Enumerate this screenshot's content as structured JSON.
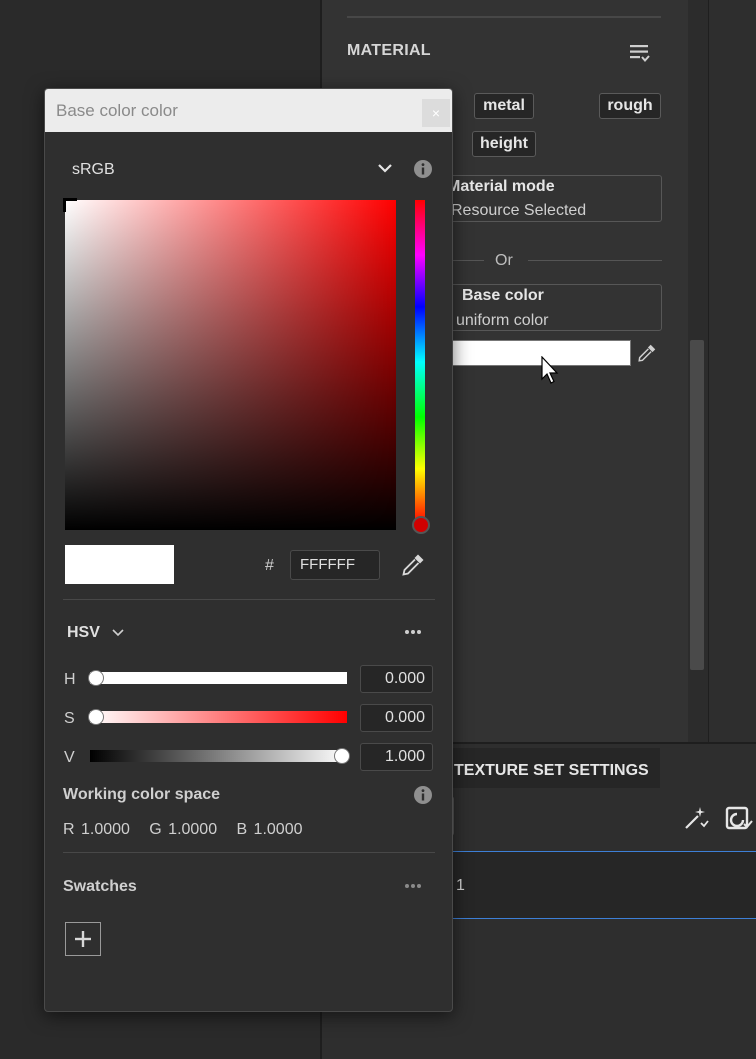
{
  "background": {
    "material_title": "MATERIAL",
    "chips": {
      "metal": "metal",
      "rough": "rough",
      "height": "height"
    },
    "material_mode": {
      "title": "Material mode",
      "value": "Resource Selected"
    },
    "or_text": "Or",
    "base_color": {
      "title": "Base color",
      "value": "uniform color",
      "swatch_color": "#FFFFFF"
    },
    "texture_set": {
      "title": "TEXTURE SET SETTINGS",
      "row_text": "1"
    },
    "icons": [
      "list-filter-icon",
      "eyedropper-icon",
      "cursor-icon",
      "magic-wand-icon",
      "refresh-icon"
    ]
  },
  "picker": {
    "title": "Base color color",
    "close_label": "×",
    "color_space": "sRGB",
    "hash": "#",
    "hex_value": "FFFFFF",
    "mode": "HSV",
    "more_label": "•••",
    "channels": [
      {
        "label": "H",
        "value": "0.000"
      },
      {
        "label": "S",
        "value": "0.000"
      },
      {
        "label": "V",
        "value": "1.000"
      }
    ],
    "working_color_space": {
      "title": "Working color space",
      "values": "R 1.0000   G 1.0000   B 1.0000"
    },
    "swatches_title": "Swatches",
    "current_color": "#FFFFFF",
    "hue_color": "#FF0000"
  }
}
